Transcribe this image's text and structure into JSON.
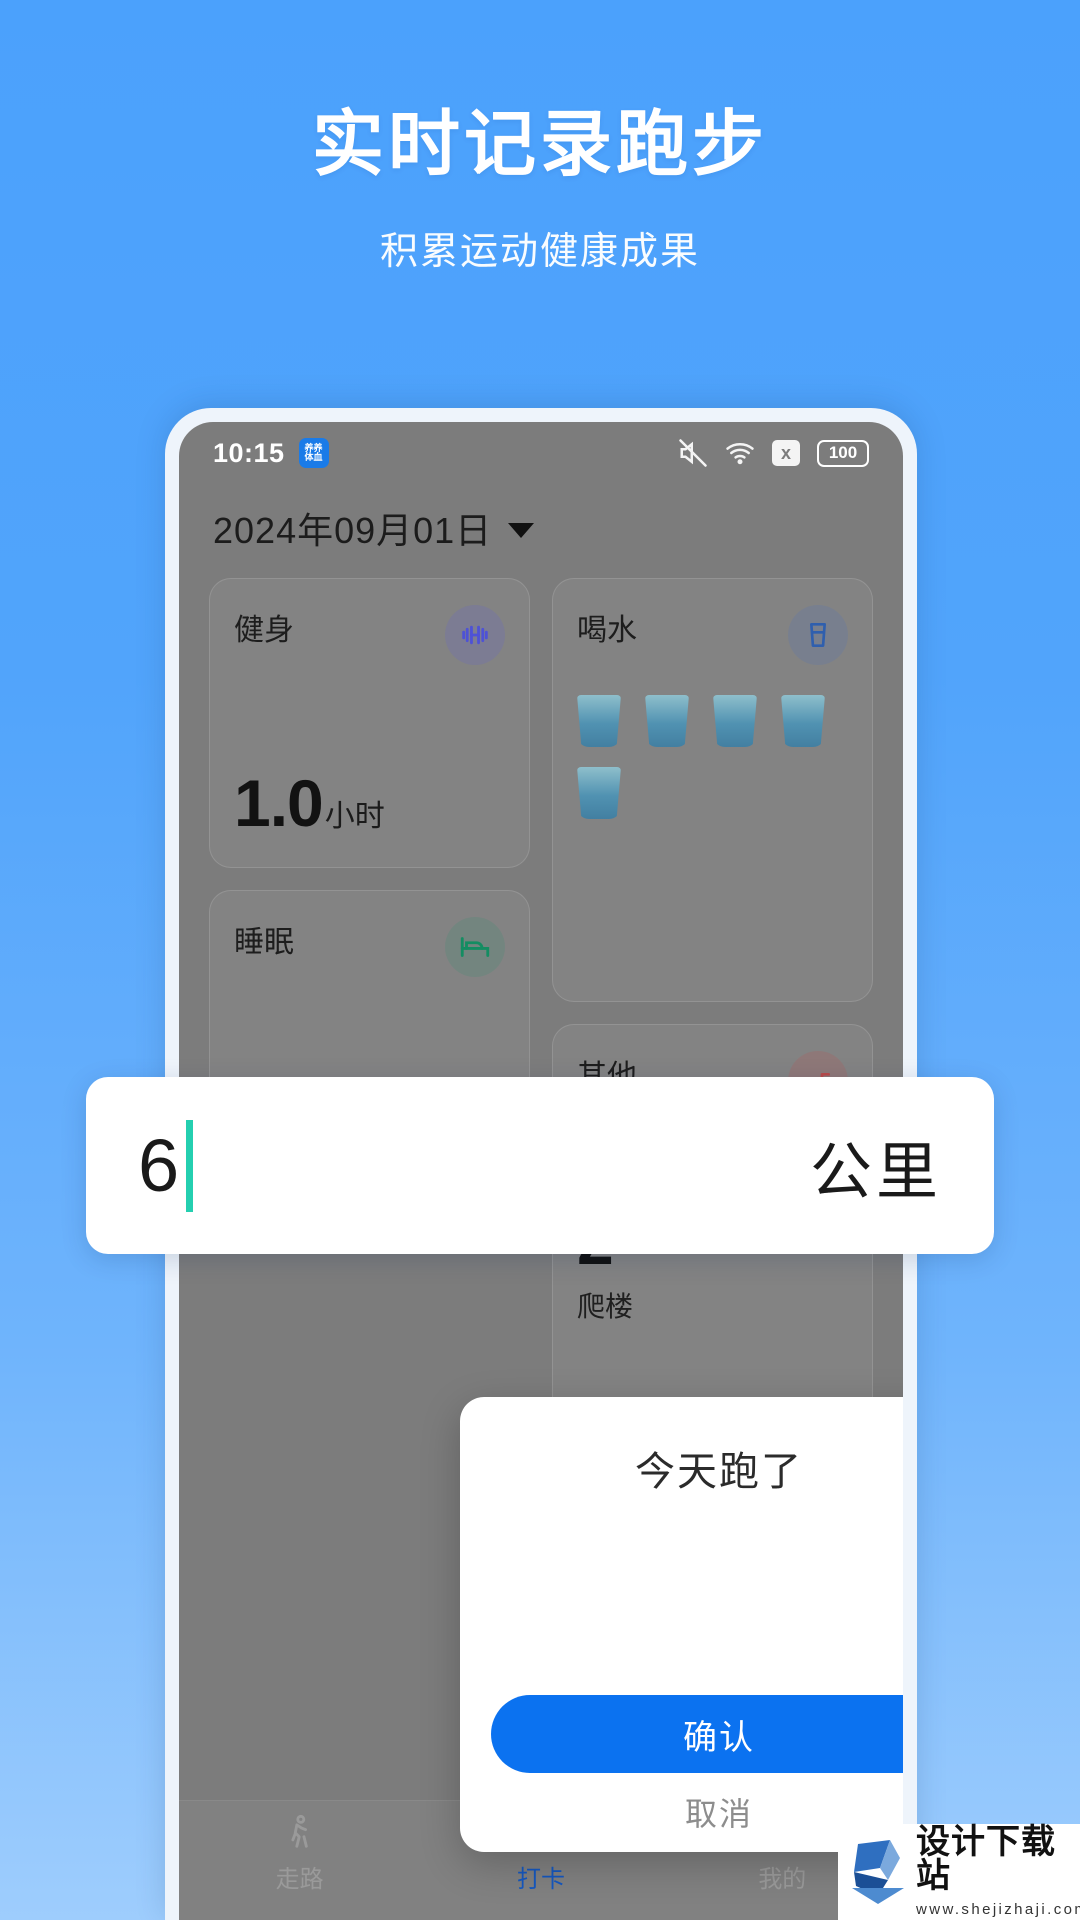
{
  "promo": {
    "title": "实时记录跑步",
    "subtitle": "积累运动健康成果",
    "bg_color": "#4da2fb"
  },
  "phone": {
    "statusbar": {
      "time": "10:15",
      "app_badge": "养养\n体血",
      "battery": "100",
      "icons": [
        "mute-icon",
        "wifi-icon",
        "x-icon",
        "battery-icon"
      ]
    },
    "header": {
      "date": "2024年09月01日",
      "caret": "chevron-down-icon"
    },
    "cards": [
      {
        "id": "fitness",
        "title": "健身",
        "icon": "dumbbell-icon",
        "value": "1.0",
        "unit": "小时"
      },
      {
        "id": "water",
        "title": "喝水",
        "icon": "water-glass-icon",
        "cups": 5
      },
      {
        "id": "sleep",
        "title": "睡眠",
        "icon": "bed-icon",
        "value": "",
        "unit": ""
      },
      {
        "id": "other",
        "title": "其他",
        "icon": "stairs-icon",
        "value": "2",
        "unit": "",
        "sub": "爬楼"
      }
    ],
    "navbar": [
      {
        "label": "走路",
        "icon": "walking-icon",
        "active": false
      },
      {
        "label": "打卡",
        "icon": "stopwatch-icon",
        "active": true
      },
      {
        "label": "我的",
        "icon": "profile-icon",
        "active": false
      }
    ]
  },
  "dialog": {
    "title": "今天跑了",
    "confirm_label": "确认",
    "cancel_label": "取消",
    "accent_color": "#0b72f0"
  },
  "input_bar": {
    "value": "6",
    "unit": "公里",
    "caret_color": "#24cfb0"
  },
  "watermark": {
    "name": "设计下载站",
    "url": "www.shejizhaji.com"
  }
}
